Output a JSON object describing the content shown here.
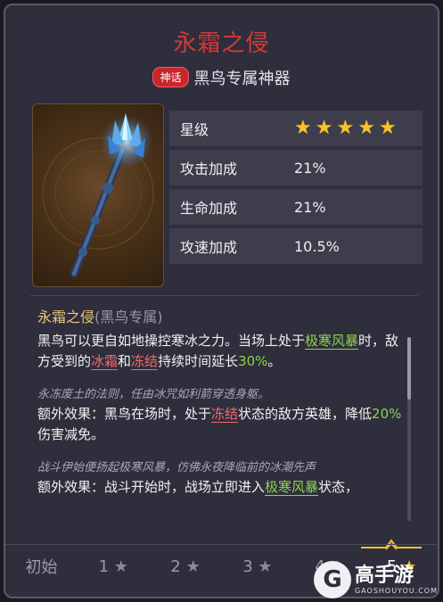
{
  "header": {
    "title": "永霜之侵",
    "badge": "神话",
    "subtitle": "黑鸟专属神器"
  },
  "stats": [
    {
      "label": "星级",
      "stars": 5
    },
    {
      "label": "攻击加成",
      "value": "21%"
    },
    {
      "label": "生命加成",
      "value": "21%"
    },
    {
      "label": "攻速加成",
      "value": "10.5%"
    }
  ],
  "description": {
    "name": "永霜之侵",
    "name_suffix": "(黑鸟专属)",
    "p1": {
      "a": "黑鸟可以更自如地操控寒冰之力。当场上处于",
      "k1": "极寒风暴",
      "b": "时，敌方受到的",
      "k2": "冰霜",
      "c": "和",
      "k3": "冻结",
      "d": "持续时间延长",
      "pct": "30%",
      "e": "。"
    },
    "lore1": "永冻废土的法则，任由冰咒如利箭穿透身躯。",
    "p2": {
      "a": "额外效果：黑鸟在场时，处于",
      "k1": "冻结",
      "b": "状态的敌方英雄，降低",
      "pct": "20%",
      "c": "伤害减免。"
    },
    "lore2": "战斗伊始便扬起极寒风暴，仿佛永夜降临前的冰潮先声",
    "p3": {
      "a": "额外效果：战斗开始时，战场立即进入",
      "k1": "极寒风暴",
      "b": "状态，"
    }
  },
  "levels": {
    "initial": "初始",
    "items": [
      "1",
      "2",
      "3",
      "4",
      "5"
    ],
    "active_index": 4
  },
  "watermark": {
    "logo": "G",
    "name": "高手游",
    "url": "GAOSHOUYOU.COM"
  },
  "colors": {
    "title": "#d23a3a",
    "star": "#f5c22a",
    "keyword_green": "#8fd44a",
    "keyword_red": "#f06a6a"
  }
}
